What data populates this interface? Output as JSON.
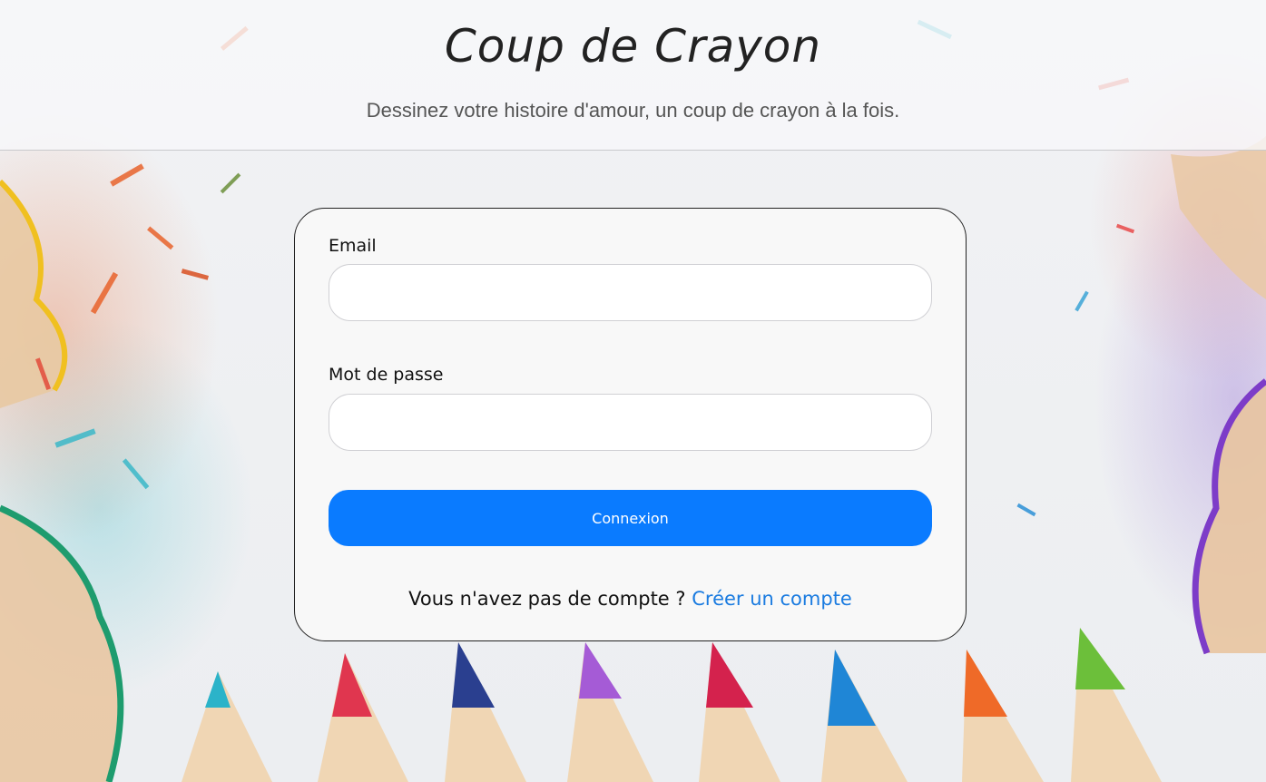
{
  "header": {
    "title": "Coup de Crayon",
    "subtitle": "Dessinez votre histoire d'amour, un coup de crayon à la fois."
  },
  "login_form": {
    "email_label": "Email",
    "email_value": "",
    "password_label": "Mot de passe",
    "password_value": "",
    "submit_label": "Connexion",
    "no_account_text": "Vous n'avez pas de compte ?",
    "create_account_link": "Créer un compte"
  },
  "colors": {
    "accent": "#0a7bff",
    "link": "#1a7be0",
    "card_background": "#f8f8f8"
  },
  "background": {
    "theme": "colored-pencil-shavings",
    "pencil_tip_colors": [
      "#2bb3c9",
      "#e0364f",
      "#2a3f8f",
      "#a55bd6",
      "#d4224d",
      "#1f86d6",
      "#ef6a28",
      "#6cbf3a"
    ]
  }
}
